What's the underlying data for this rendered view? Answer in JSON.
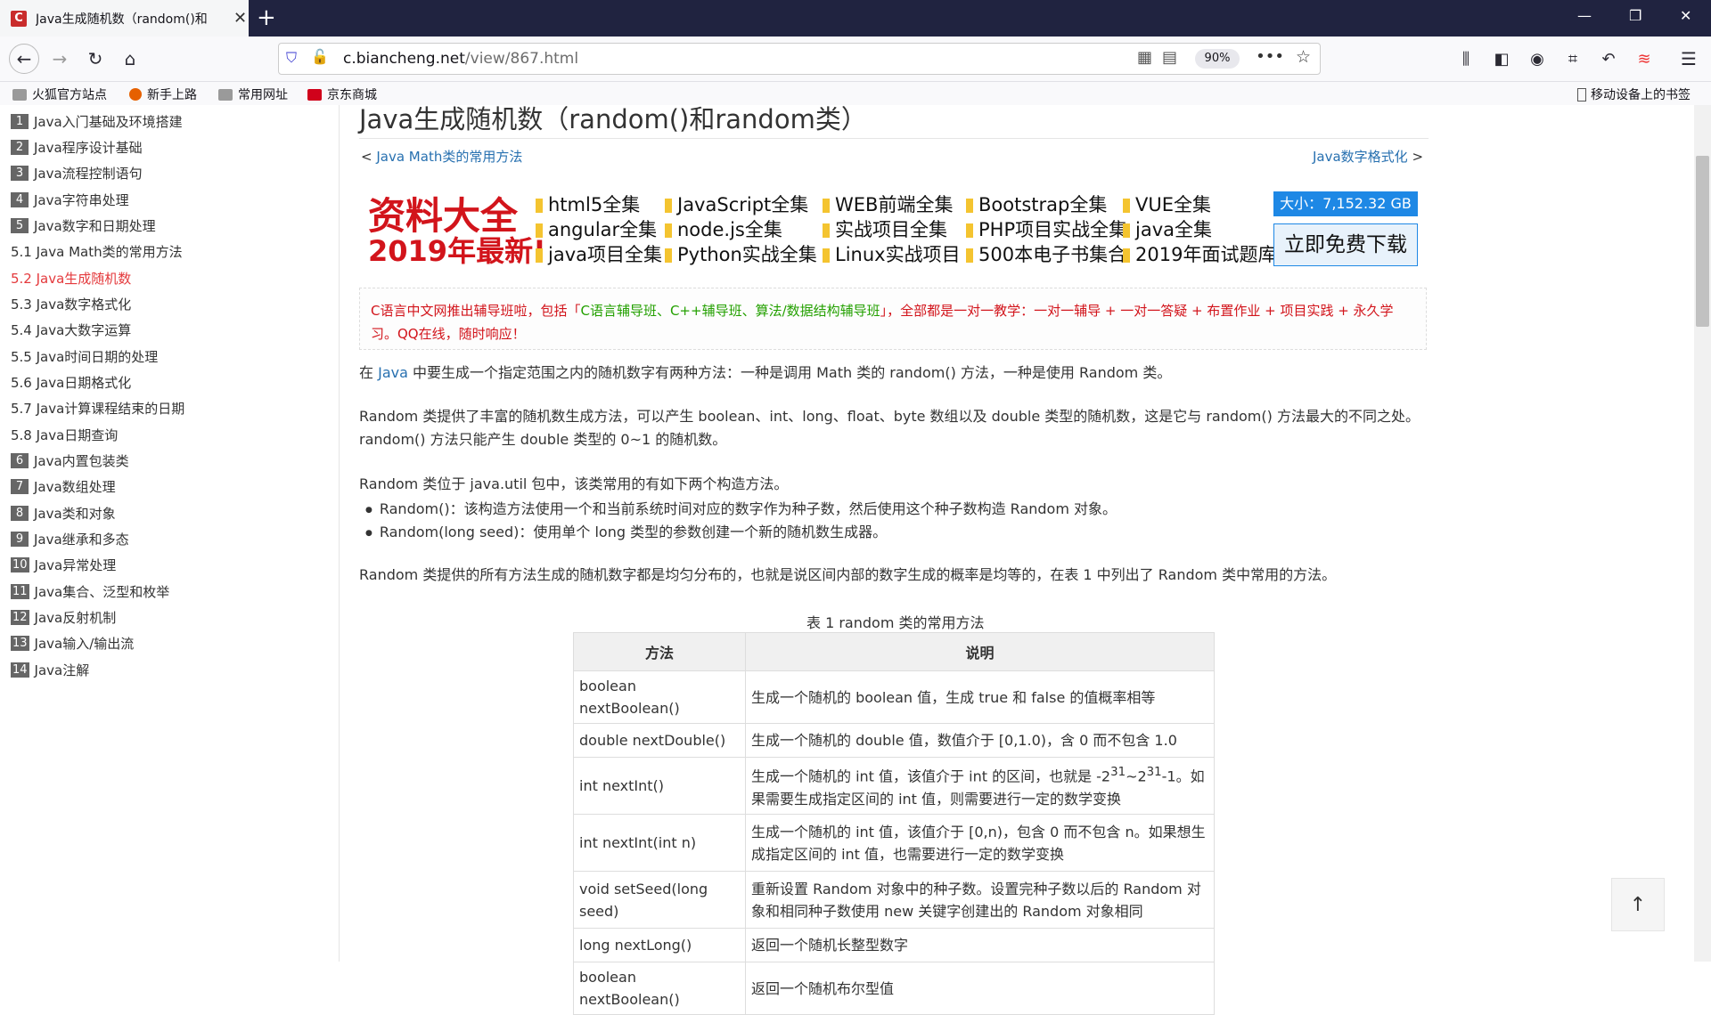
{
  "browser": {
    "tab_title": "Java生成随机数（random()和",
    "tab_favicon": "C",
    "url_host": "c.biancheng.net",
    "url_path": "/view/867.html",
    "zoom": "90%"
  },
  "bookmarks": [
    {
      "label": "火狐官方站点"
    },
    {
      "label": "新手上路"
    },
    {
      "label": "常用网址"
    },
    {
      "label": "京东商城"
    }
  ],
  "mobile_bookmarks": "移动设备上的书签",
  "sidebar": [
    {
      "num": "1",
      "label": "Java入门基础及环境搭建"
    },
    {
      "num": "2",
      "label": "Java程序设计基础"
    },
    {
      "num": "3",
      "label": "Java流程控制语句"
    },
    {
      "num": "4",
      "label": "Java字符串处理"
    },
    {
      "num": "5",
      "label": "Java数字和日期处理"
    },
    {
      "label": "5.1 Java Math类的常用方法"
    },
    {
      "label": "5.2 Java生成随机数"
    },
    {
      "label": "5.3 Java数字格式化"
    },
    {
      "label": "5.4 Java大数字运算"
    },
    {
      "label": "5.5 Java时间日期的处理"
    },
    {
      "label": "5.6 Java日期格式化"
    },
    {
      "label": "5.7 Java计算课程结束的日期"
    },
    {
      "label": "5.8 Java日期查询"
    },
    {
      "num": "6",
      "label": "Java内置包装类"
    },
    {
      "num": "7",
      "label": "Java数组处理"
    },
    {
      "num": "8",
      "label": "Java类和对象"
    },
    {
      "num": "9",
      "label": "Java继承和多态"
    },
    {
      "num": "10",
      "label": "Java异常处理"
    },
    {
      "num": "11",
      "label": "Java集合、泛型和枚举"
    },
    {
      "num": "12",
      "label": "Java反射机制"
    },
    {
      "num": "13",
      "label": "Java输入/输出流"
    },
    {
      "num": "14",
      "label": "Java注解"
    }
  ],
  "page": {
    "title": "Java生成随机数（random()和random类）",
    "prev_lt": "<",
    "prev": "Java Math类的常用方法",
    "next": "Java数字格式化",
    "next_gt": ">",
    "banner_big1": "资料大全",
    "banner_big2": "2019年最新!",
    "banner_links": [
      "html5全集",
      "JavaScript全集",
      "WEB前端全集",
      "Bootstrap全集",
      "VUE全集",
      "angular全集",
      "node.js全集",
      "实战项目全集",
      "PHP项目实战全集",
      "java全集",
      "java项目全集",
      "Python实战全集",
      "Linux实战项目",
      "500本电子书集合",
      "2019年面试题库"
    ],
    "banner_size": "大小：7,152.32 GB",
    "banner_download": "立即免费下载",
    "notice_a": "C语言中文网推出辅导班啦，包括「",
    "notice_b": "C语言辅导班、C++辅导班、算法/数据结构辅导班",
    "notice_c": "」，全部都是一对一教学：一对一辅导 + 一对一答疑 + 布置作业 + 项目实践 + 永久学习。QQ在线，随时响应！",
    "p1_a": "在",
    "p1_link": "Java",
    "p1_b": "中要生成一个指定范围之内的随机数字有两种方法：一种是调用 Math 类的 random() 方法，一种是使用 Random 类。",
    "p2": "Random 类提供了丰富的随机数生成方法，可以产生 boolean、int、long、float、byte 数组以及 double 类型的随机数，这是它与 random() 方法最大的不同之处。random() 方法只能产生 double 类型的 0~1 的随机数。",
    "p3": "Random 类位于 java.util 包中，该类常用的有如下两个构造方法。",
    "li1": "Random()：该构造方法使用一个和当前系统时间对应的数字作为种子数，然后使用这个种子数构造 Random 对象。",
    "li2": "Random(long seed)：使用单个 long 类型的参数创建一个新的随机数生成器。",
    "p4": "Random 类提供的所有方法生成的随机数字都是均匀分布的，也就是说区间内部的数字生成的概率是均等的，在表 1 中列出了 Random 类中常用的方法。",
    "table_caption": "表 1 random 类的常用方法",
    "table_headers": [
      "方法",
      "说明"
    ],
    "rows": [
      {
        "method": "boolean nextBoolean()",
        "desc": "生成一个随机的 boolean 值，生成 true 和 false 的值概率相等"
      },
      {
        "method": "double nextDouble()",
        "desc": "生成一个随机的 double 值，数值介于 [0,1.0)，含 0 而不包含 1.0"
      },
      {
        "method": "int nextInt()",
        "desc_a": "生成一个随机的 int 值，该值介于 int 的区间，也就是 -2",
        "sup1": "31",
        "desc_b": "~2",
        "sup2": "31",
        "desc_c": "-1。如果需要生成指定区间的 int 值，则需要进行一定的数学变换"
      },
      {
        "method": "int nextInt(int n)",
        "desc": "生成一个随机的 int 值，该值介于 [0,n)，包含 0 而不包含 n。如果想生成指定区间的 int 值，也需要进行一定的数学变换"
      },
      {
        "method": "void setSeed(long seed)",
        "desc": "重新设置 Random 对象中的种子数。设置完种子数以后的 Random 对象和相同种子数使用 new 关键字创建出的 Random 对象相同"
      },
      {
        "method": "long nextLong()",
        "desc": "返回一个随机长整型数字"
      },
      {
        "method": "boolean nextBoolean()",
        "desc": "返回一个随机布尔型值"
      }
    ],
    "to_top": "↑"
  }
}
